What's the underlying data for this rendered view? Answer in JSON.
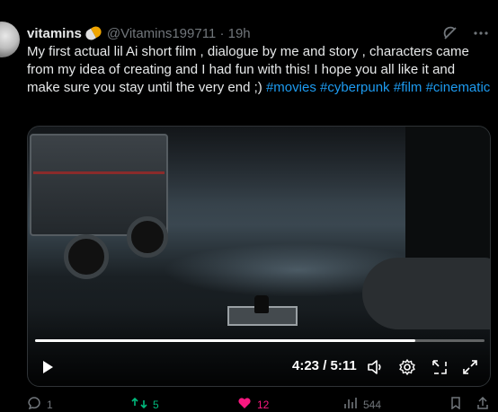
{
  "post": {
    "display_name": "vitamins",
    "handle": "@Vitamins199711",
    "separator": "·",
    "age": "19h",
    "text_plain": "My first actual lil Ai short film , dialogue by me and story , characters came from my idea of creating and I had fun with this! I hope you all like it and make sure you stay until the very end ;)",
    "hashtags": [
      "#movies",
      "#cyberpunk",
      "#film",
      "#cinematic"
    ]
  },
  "video": {
    "current_time": "4:23",
    "time_sep": "/",
    "duration": "5:11",
    "progress_fraction": 0.846
  },
  "actions": {
    "replies": "1",
    "reposts": "5",
    "likes": "12",
    "views": "544"
  },
  "colors": {
    "background": "#000000",
    "text": "#e7e9ea",
    "muted": "#71767b",
    "link": "#1d9bf0",
    "repost": "#00ba7c",
    "like": "#f91880"
  },
  "icons": [
    "grok-icon",
    "more-icon",
    "play-icon",
    "volume-icon",
    "settings-icon",
    "pip-icon",
    "fullscreen-icon",
    "reply-icon",
    "repost-icon",
    "like-icon",
    "views-icon",
    "bookmark-icon"
  ]
}
